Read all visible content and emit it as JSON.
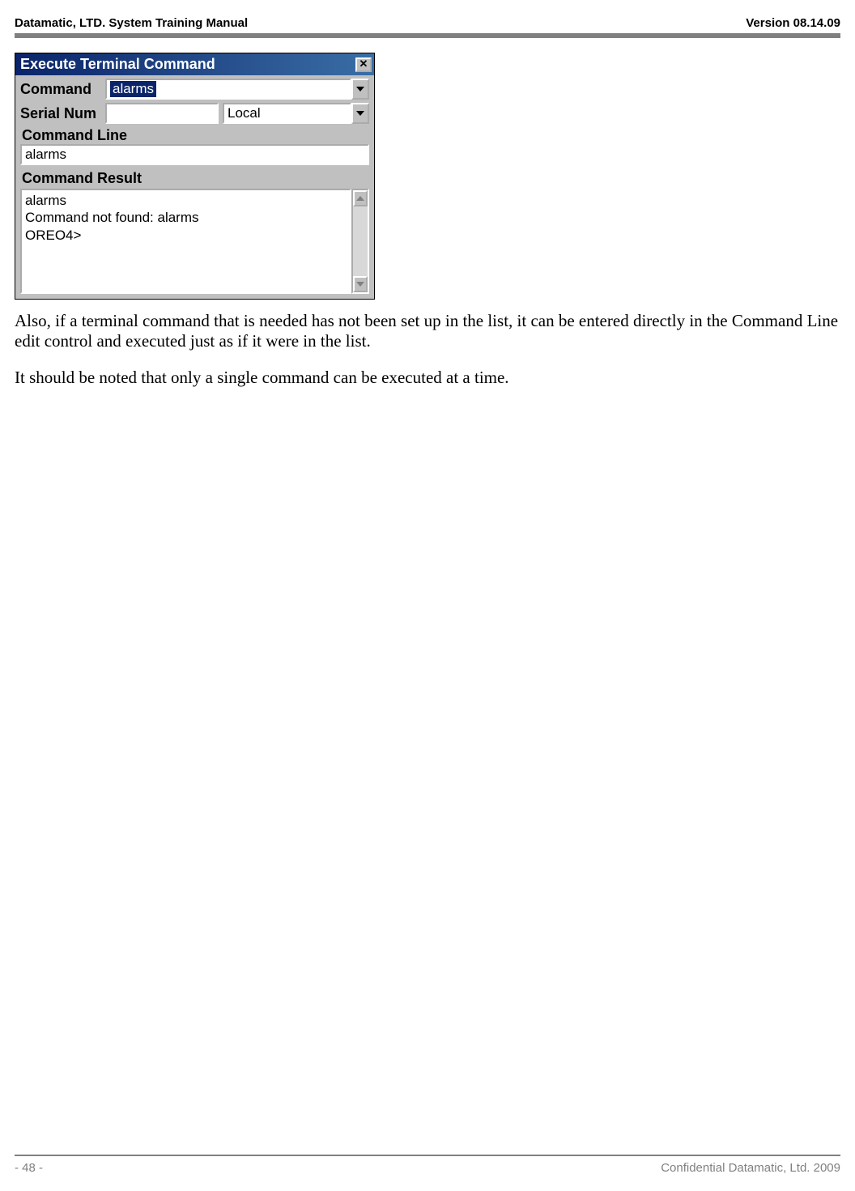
{
  "header": {
    "left": "Datamatic, LTD. System Training  Manual",
    "right": "Version 08.14.09"
  },
  "dialog": {
    "title": "Execute Terminal Command",
    "close_symbol": "✕",
    "command_label": "Command",
    "command_value": "alarms",
    "serial_label": "Serial Num",
    "serial_value": "",
    "scope_value": "Local",
    "cmdline_label": "Command Line",
    "cmdline_value": "alarms",
    "result_label": "Command Result",
    "result_text": "alarms\nCommand not found: alarms\nOREO4>"
  },
  "body": {
    "p1": "Also, if a terminal command that is needed has not been set up in the list, it can be entered directly in the Command Line edit control and executed just as if it were in the list.",
    "p2": "It should be noted that only a single command can be executed at a time."
  },
  "footer": {
    "page": "- 48 -",
    "conf": "Confidential Datamatic, Ltd. 2009"
  }
}
